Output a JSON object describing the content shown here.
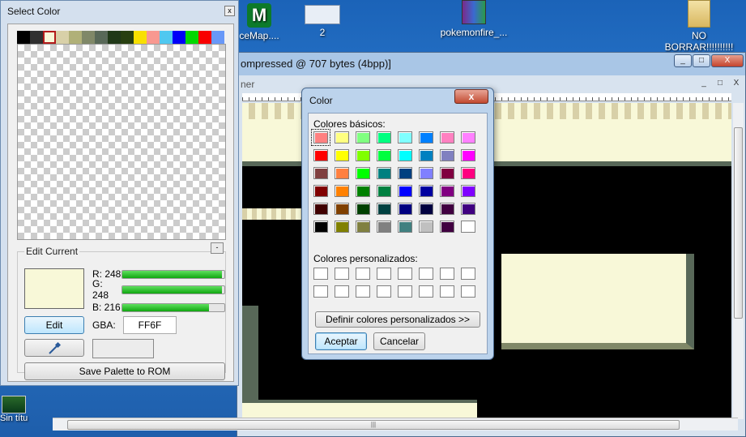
{
  "desktop": {
    "icons": [
      {
        "label": "ceMap....",
        "icon": "map-app-icon"
      },
      {
        "label": "2",
        "icon": "window-thumbnail-icon"
      },
      {
        "label": "pokemonfire_...",
        "icon": "winrar-archive-icon"
      },
      {
        "label": "NO BORRAR!!!!!!!!!!",
        "icon": "folder-icon"
      },
      {
        "label": "Sin títu",
        "icon": "image-thumbnail-icon"
      }
    ]
  },
  "main_window": {
    "title": "ompressed @ 707 bytes (4bpp)]",
    "inner_title": "ner",
    "controls": [
      "_",
      "□",
      "X"
    ],
    "scroll_grip": "|||"
  },
  "select_color": {
    "title": "Select Color",
    "close": "x",
    "palette": [
      "#000000",
      "#303030",
      "#f8f8d8",
      "#d8d0a8",
      "#b0b078",
      "#808868",
      "#586858",
      "#203818",
      "#284010",
      "#f8e000",
      "#f89890",
      "#50c8f0",
      "#0000f8",
      "#00d800",
      "#f80000",
      "#6898f8"
    ],
    "edit_current_label": "Edit Current",
    "collapse": "-",
    "color_hex": "#f8f8d8",
    "r_label": "R: 248",
    "r_value": 248,
    "g_label": "G: 248",
    "g_value": 248,
    "b_label": "B: 216",
    "b_value": 216,
    "edit_button": "Edit",
    "gba_label": "GBA:",
    "gba_value": "FF6F",
    "save_button": "Save Palette to ROM"
  },
  "color_dialog": {
    "title": "Color",
    "close": "x",
    "basic_label": "Colores básicos:",
    "basic_colors": [
      "#ff8080",
      "#ffff80",
      "#80ff80",
      "#00ff80",
      "#80ffff",
      "#0080ff",
      "#ff80c0",
      "#ff80ff",
      "#ff0000",
      "#ffff00",
      "#80ff00",
      "#00ff40",
      "#00ffff",
      "#0080c0",
      "#8080c0",
      "#ff00ff",
      "#804040",
      "#ff8040",
      "#00ff00",
      "#008080",
      "#004080",
      "#8080ff",
      "#800040",
      "#ff0080",
      "#800000",
      "#ff8000",
      "#008000",
      "#008040",
      "#0000ff",
      "#0000a0",
      "#800080",
      "#8000ff",
      "#400000",
      "#804000",
      "#004000",
      "#004040",
      "#000080",
      "#000040",
      "#400040",
      "#400080",
      "#000000",
      "#808000",
      "#808040",
      "#808080",
      "#408080",
      "#c0c0c0",
      "#400040",
      "#ffffff"
    ],
    "custom_label": "Colores personalizados:",
    "custom_colors": [
      "#ffffff",
      "#ffffff",
      "#ffffff",
      "#ffffff",
      "#ffffff",
      "#ffffff",
      "#ffffff",
      "#ffffff",
      "#ffffff",
      "#ffffff",
      "#ffffff",
      "#ffffff",
      "#ffffff",
      "#ffffff",
      "#ffffff",
      "#ffffff"
    ],
    "define_button": "Definir colores personalizados >>",
    "ok_button": "Aceptar",
    "cancel_button": "Cancelar"
  }
}
